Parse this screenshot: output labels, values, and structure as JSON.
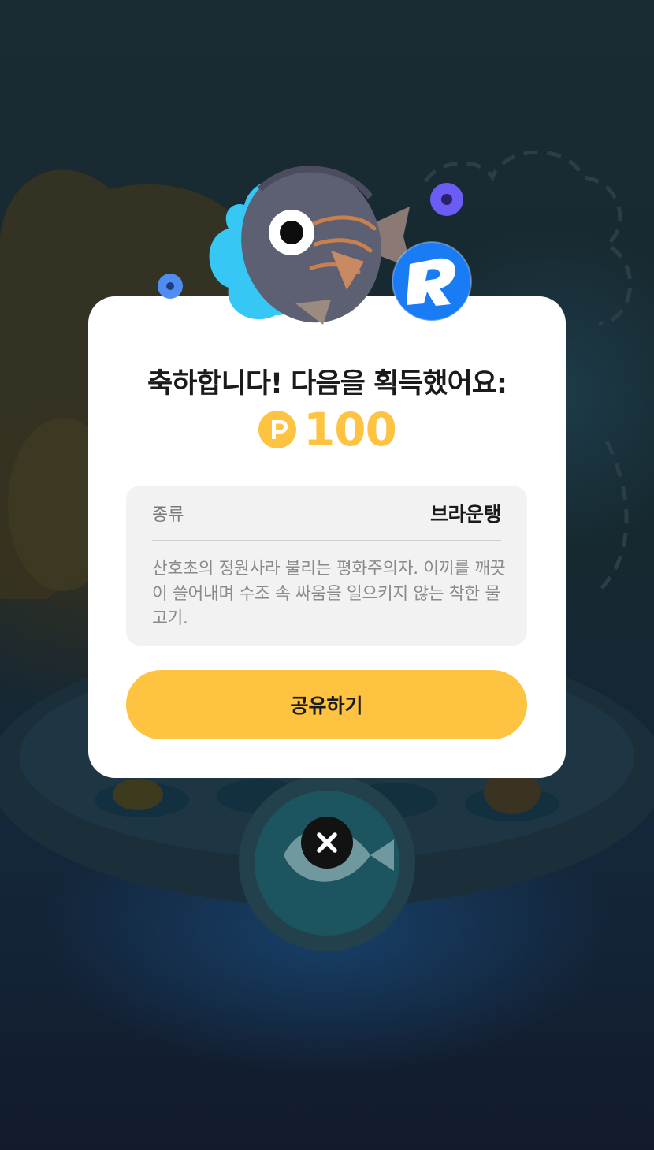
{
  "modal": {
    "title": "축하합니다! 다음을 획득했어요:",
    "reward": {
      "currency_icon": "point-coin-icon",
      "currency_symbol": "P",
      "amount": "100",
      "color": "#fdc341"
    },
    "fish_info": {
      "label": "종류",
      "species": "브라운탱",
      "description": "산호초의 정원사라 불리는 평화주의자. 이끼를 깨끗이 쓸어내며 수조 속 싸움을 일으키지 않는 착한 물고기."
    },
    "share_button_label": "공유하기",
    "close_icon": "close-icon"
  },
  "badges": {
    "brand_badge_letter": "R",
    "brand_badge_color": "#1a7cf5"
  },
  "colors": {
    "accent": "#fdc341",
    "card_bg": "#ffffff",
    "info_bg": "#f2f2f2"
  }
}
